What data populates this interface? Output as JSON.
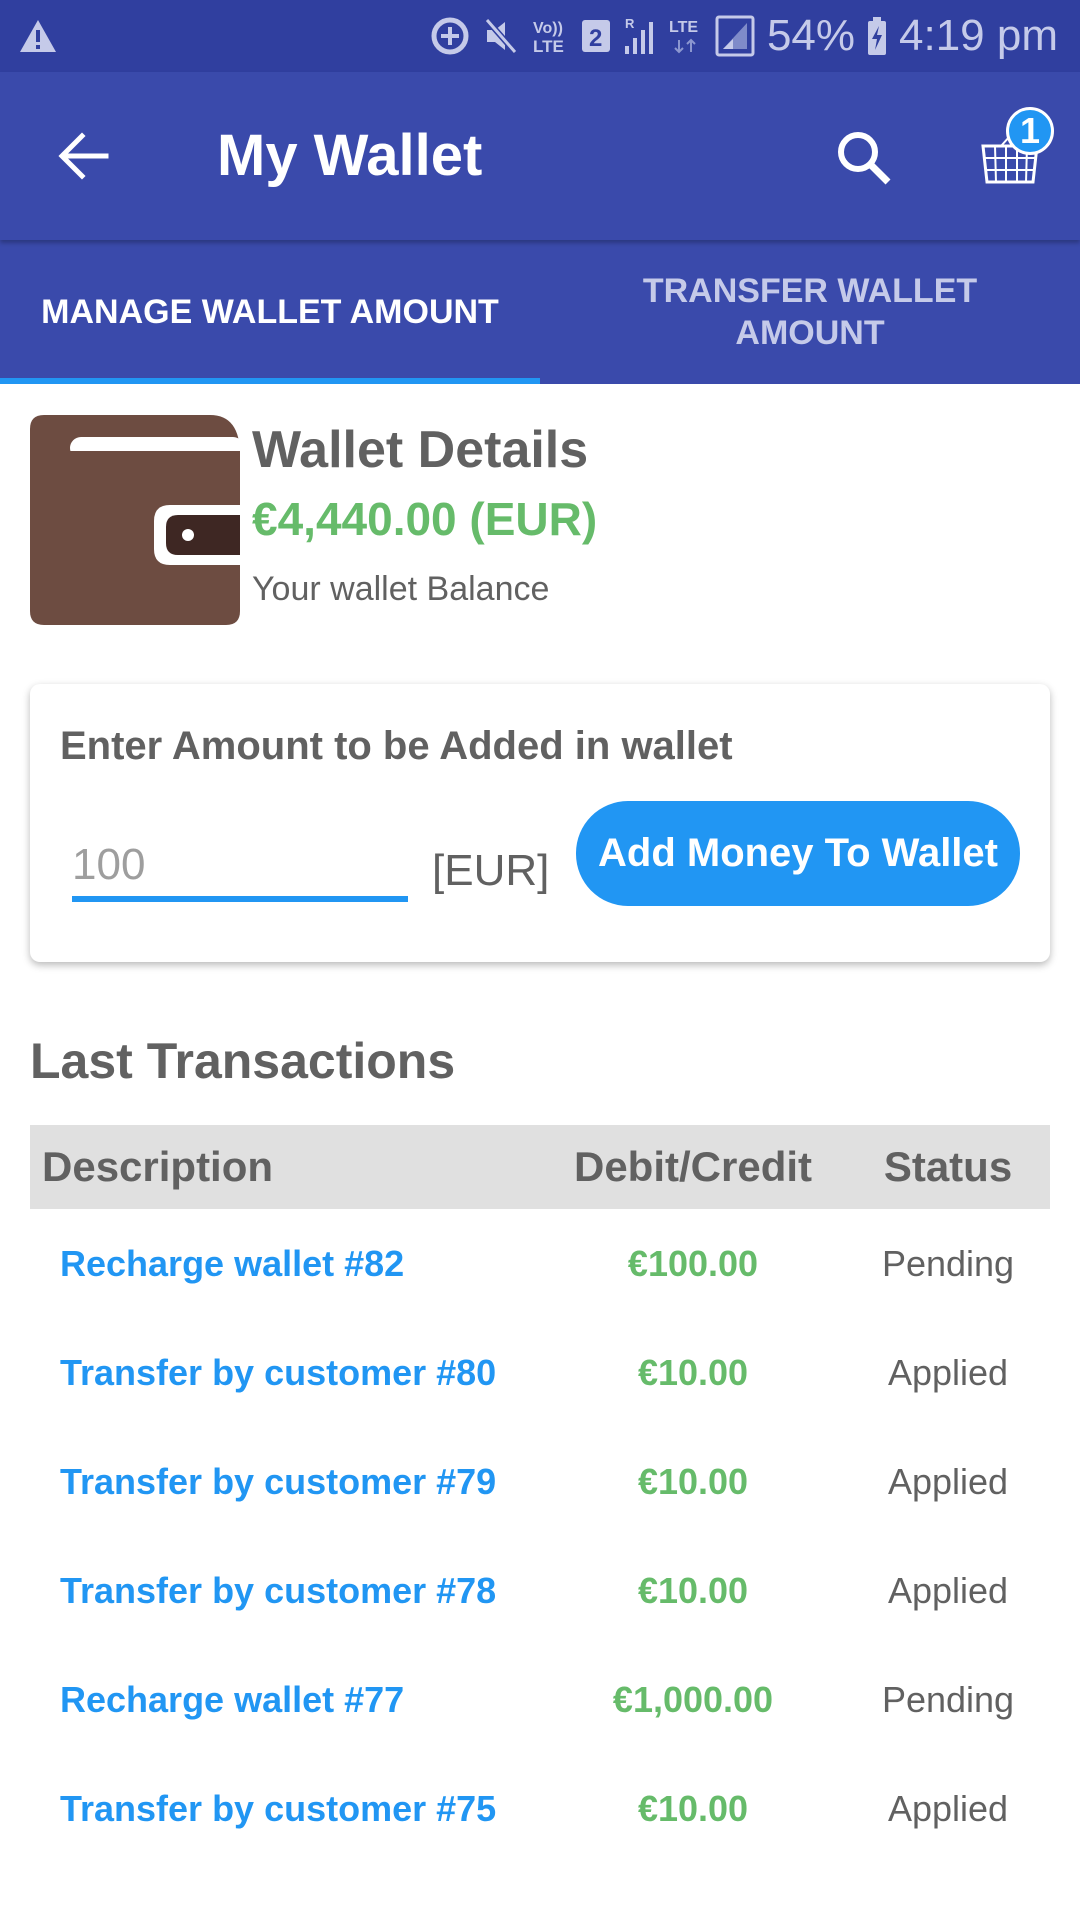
{
  "status_bar": {
    "icons": [
      "warning-icon",
      "data-saver-icon",
      "mute-icon",
      "volte-icon",
      "sim2-icon",
      "roaming-signal-icon",
      "lte-data-icon",
      "signal-icon",
      "battery-charging-icon"
    ],
    "sim_label": "2",
    "battery": "54%",
    "time": "4:19 pm"
  },
  "toolbar": {
    "title": "My Wallet",
    "cart_count": "1"
  },
  "tabs": [
    {
      "label": "MANAGE WALLET AMOUNT",
      "active": true
    },
    {
      "label": "TRANSFER WALLET AMOUNT",
      "active": false
    }
  ],
  "wallet": {
    "title": "Wallet Details",
    "balance": "€4,440.00 (EUR)",
    "subtitle": "Your wallet Balance"
  },
  "add_money": {
    "heading": "Enter Amount to be Added in wallet",
    "placeholder": "100",
    "value": "",
    "currency": "[EUR]",
    "button_label": "Add Money To Wallet"
  },
  "transactions": {
    "title": "Last Transactions",
    "headers": {
      "description": "Description",
      "amount": "Debit/Credit",
      "status": "Status"
    },
    "rows": [
      {
        "description": "Recharge wallet #82",
        "amount": "€100.00",
        "status": "Pending"
      },
      {
        "description": "Transfer by customer #80",
        "amount": "€10.00",
        "status": "Applied"
      },
      {
        "description": "Transfer by customer #79",
        "amount": "€10.00",
        "status": "Applied"
      },
      {
        "description": "Transfer by customer #78",
        "amount": "€10.00",
        "status": "Applied"
      },
      {
        "description": "Recharge wallet #77",
        "amount": "€1,000.00",
        "status": "Pending"
      },
      {
        "description": "Transfer by customer #75",
        "amount": "€10.00",
        "status": "Applied"
      }
    ]
  },
  "colors": {
    "primary": "#3a4aab",
    "primary_dark": "#303f9f",
    "accent": "#2196f3",
    "amount_green": "#66bb6a",
    "text_gray": "#616161",
    "wallet_brown": "#6d4c41"
  }
}
